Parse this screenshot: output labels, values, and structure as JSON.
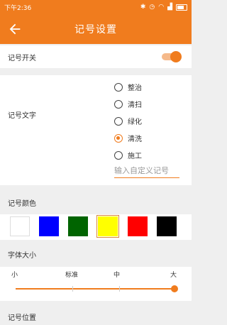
{
  "status": {
    "time": "下午2:36"
  },
  "appbar": {
    "title": "记号设置"
  },
  "toggle_section": {
    "label": "记号开关",
    "on": true
  },
  "text_section": {
    "label": "记号文字",
    "options": [
      {
        "label": "整治",
        "checked": false
      },
      {
        "label": "清扫",
        "checked": false
      },
      {
        "label": "绿化",
        "checked": false
      },
      {
        "label": "清洗",
        "checked": true
      },
      {
        "label": "施工",
        "checked": false
      }
    ],
    "custom_placeholder": "输入自定义记号"
  },
  "color_section": {
    "label": "记号颜色",
    "swatches": [
      "#ffffff",
      "#0000ff",
      "#006400",
      "#ffff00",
      "#ff0000",
      "#000000"
    ],
    "selected_index": 3
  },
  "size_section": {
    "label": "字体大小",
    "marks": [
      "小",
      "标准",
      "中",
      "大"
    ],
    "value_index": 3
  },
  "position_section": {
    "label": "记号位置"
  },
  "colors": {
    "accent": "#f07c1e"
  }
}
